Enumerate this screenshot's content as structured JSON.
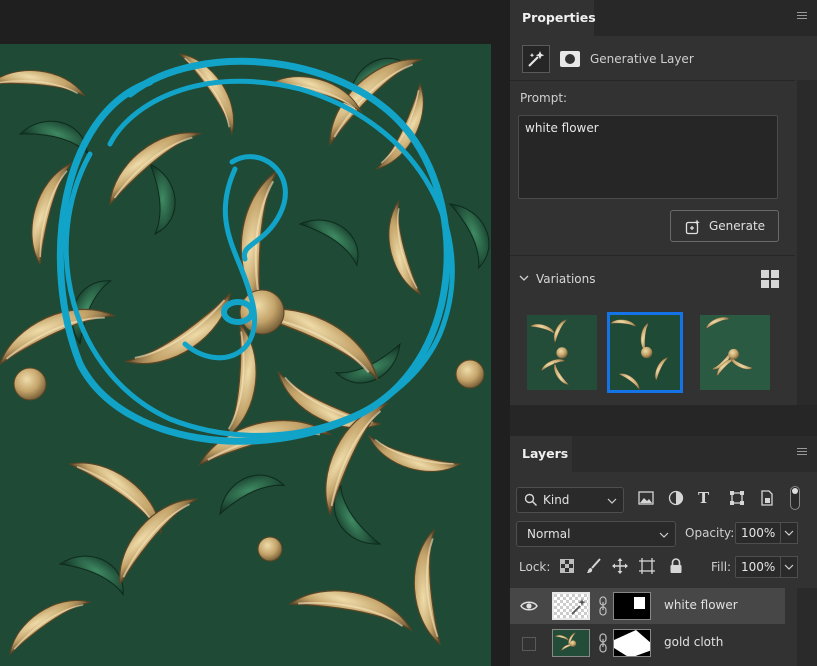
{
  "properties": {
    "tab_label": "Properties",
    "layer_type": "Generative Layer",
    "prompt_label": "Prompt:",
    "prompt_value": "white flower",
    "generate_label": "Generate",
    "variations_label": "Variations",
    "variations": [
      {
        "name": "variation-1",
        "selected": false
      },
      {
        "name": "variation-2",
        "selected": true
      },
      {
        "name": "variation-3",
        "selected": false
      }
    ]
  },
  "layers": {
    "tab_label": "Layers",
    "filter_kind": "Kind",
    "blend_mode": "Normal",
    "opacity_label": "Opacity:",
    "opacity_value": "100%",
    "lock_label": "Lock:",
    "fill_label": "Fill:",
    "fill_value": "100%",
    "items": [
      {
        "name": "white flower",
        "visible": true,
        "selected": true
      },
      {
        "name": "gold cloth",
        "visible": false,
        "selected": false
      }
    ]
  },
  "colors": {
    "panel_bg": "#323232",
    "accent_blue": "#1473e6",
    "annotation_cyan": "#12a3c9",
    "gold": "#c4a46a",
    "green": "#2f6b4c"
  },
  "icons": [
    "generative-layer-icon",
    "mask-icon",
    "generate-icon",
    "chevron-down-icon",
    "grid-view-icon",
    "search-icon",
    "image-filter-icon",
    "adjustment-filter-icon",
    "type-filter-icon",
    "shape-filter-icon",
    "smart-object-filter-icon",
    "eye-icon",
    "link-icon",
    "lock-transparent-icon",
    "lock-paint-icon",
    "lock-move-icon",
    "lock-artboard-icon",
    "lock-all-icon"
  ]
}
